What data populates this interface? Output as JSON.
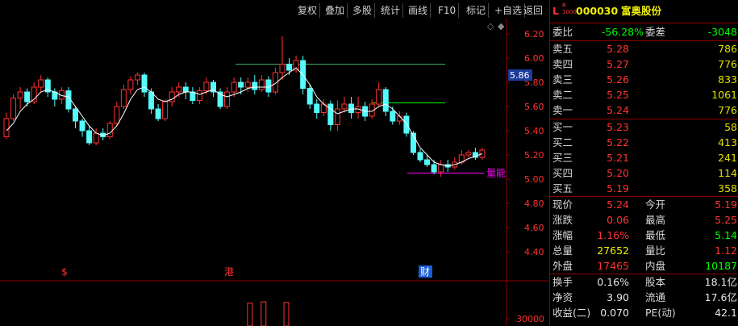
{
  "colors": {
    "up": "#ff3232",
    "down": "#54fcfc",
    "bg": "#000000",
    "grid": "#8b0000",
    "ma": "#ffffff",
    "yellow": "#f0f000",
    "purple": "#ff00ff",
    "green": "#00ff00"
  },
  "toolbar": {
    "items": [
      "复权",
      "叠加",
      "多股",
      "统计",
      "画线",
      "F10",
      "标记",
      "+自选",
      "返回"
    ]
  },
  "chart": {
    "y_ticks": [
      "6.20",
      "6.00",
      "5.80",
      "5.60",
      "5.40",
      "5.20",
      "5.00",
      "4.80",
      "4.60",
      "4.40"
    ],
    "current_price": "5.86",
    "vol_tick": "30000",
    "markers": [
      {
        "text": "$",
        "color": "#ff3232"
      },
      {
        "text": "港",
        "color": "#ff3232"
      },
      {
        "text": "财",
        "color": "#ffffff"
      }
    ],
    "indicator_label": "量能",
    "level_lines": [
      5.95,
      5.63,
      5.05
    ]
  },
  "chart_data": {
    "type": "candlestick",
    "ylim": [
      4.3,
      6.28
    ],
    "series": [
      {
        "name": "ohlc",
        "values": [
          [
            5.35,
            5.5,
            5.33,
            5.55
          ],
          [
            5.5,
            5.67,
            5.48,
            5.7
          ],
          [
            5.67,
            5.72,
            5.58,
            5.76
          ],
          [
            5.72,
            5.64,
            5.6,
            5.75
          ],
          [
            5.64,
            5.76,
            5.62,
            5.8
          ],
          [
            5.76,
            5.82,
            5.72,
            5.86
          ],
          [
            5.82,
            5.72,
            5.68,
            5.84
          ],
          [
            5.72,
            5.66,
            5.6,
            5.75
          ],
          [
            5.66,
            5.73,
            5.62,
            5.76
          ],
          [
            5.73,
            5.58,
            5.55,
            5.76
          ],
          [
            5.58,
            5.48,
            5.42,
            5.6
          ],
          [
            5.48,
            5.4,
            5.35,
            5.5
          ],
          [
            5.4,
            5.3,
            5.28,
            5.44
          ],
          [
            5.3,
            5.38,
            5.28,
            5.42
          ],
          [
            5.38,
            5.35,
            5.32,
            5.42
          ],
          [
            5.35,
            5.46,
            5.33,
            5.48
          ],
          [
            5.46,
            5.6,
            5.44,
            5.64
          ],
          [
            5.6,
            5.74,
            5.58,
            5.78
          ],
          [
            5.74,
            5.82,
            5.7,
            5.85
          ],
          [
            5.82,
            5.86,
            5.78,
            5.88
          ],
          [
            5.86,
            5.72,
            5.68,
            5.88
          ],
          [
            5.72,
            5.58,
            5.54,
            5.75
          ],
          [
            5.58,
            5.5,
            5.48,
            5.62
          ],
          [
            5.5,
            5.64,
            5.48,
            5.66
          ],
          [
            5.64,
            5.72,
            5.6,
            5.76
          ],
          [
            5.72,
            5.76,
            5.68,
            5.8
          ],
          [
            5.76,
            5.72,
            5.66,
            5.8
          ],
          [
            5.72,
            5.65,
            5.62,
            5.76
          ],
          [
            5.65,
            5.73,
            5.62,
            5.76
          ],
          [
            5.73,
            5.8,
            5.7,
            5.84
          ],
          [
            5.8,
            5.72,
            5.68,
            5.82
          ],
          [
            5.72,
            5.6,
            5.58,
            5.75
          ],
          [
            5.6,
            5.72,
            5.58,
            5.76
          ],
          [
            5.72,
            5.8,
            5.68,
            5.84
          ],
          [
            5.8,
            5.76,
            5.7,
            5.84
          ],
          [
            5.76,
            5.8,
            5.72,
            5.84
          ],
          [
            5.8,
            5.74,
            5.7,
            5.86
          ],
          [
            5.74,
            5.82,
            5.72,
            5.86
          ],
          [
            5.82,
            5.72,
            5.68,
            5.85
          ],
          [
            5.72,
            5.88,
            5.7,
            5.92
          ],
          [
            5.88,
            5.95,
            5.82,
            6.18
          ],
          [
            5.95,
            5.9,
            5.86,
            6.0
          ],
          [
            5.9,
            5.98,
            5.88,
            6.02
          ],
          [
            5.98,
            5.75,
            5.7,
            6.02
          ],
          [
            5.75,
            5.62,
            5.58,
            5.78
          ],
          [
            5.62,
            5.55,
            5.5,
            5.66
          ],
          [
            5.55,
            5.62,
            5.52,
            5.66
          ],
          [
            5.62,
            5.45,
            5.4,
            5.65
          ],
          [
            5.45,
            5.58,
            5.4,
            5.65
          ],
          [
            5.58,
            5.62,
            5.55,
            5.68
          ],
          [
            5.62,
            5.55,
            5.5,
            5.68
          ],
          [
            5.55,
            5.6,
            5.5,
            5.68
          ],
          [
            5.6,
            5.52,
            5.48,
            5.64
          ],
          [
            5.52,
            5.62,
            5.5,
            5.66
          ],
          [
            5.62,
            5.74,
            5.6,
            5.8
          ],
          [
            5.74,
            5.56,
            5.52,
            5.76
          ],
          [
            5.56,
            5.48,
            5.45,
            5.6
          ],
          [
            5.48,
            5.52,
            5.45,
            5.56
          ],
          [
            5.52,
            5.38,
            5.35,
            5.55
          ],
          [
            5.38,
            5.22,
            5.2,
            5.4
          ],
          [
            5.22,
            5.16,
            5.14,
            5.25
          ],
          [
            5.16,
            5.12,
            5.1,
            5.2
          ],
          [
            5.12,
            5.06,
            5.04,
            5.16
          ],
          [
            5.06,
            5.12,
            5.02,
            5.16
          ],
          [
            5.12,
            5.1,
            5.06,
            5.16
          ],
          [
            5.1,
            5.14,
            5.08,
            5.18
          ],
          [
            5.14,
            5.2,
            5.12,
            5.24
          ],
          [
            5.2,
            5.22,
            5.18,
            5.24
          ],
          [
            5.22,
            5.18,
            5.16,
            5.26
          ],
          [
            5.18,
            5.24,
            5.16,
            5.26
          ]
        ]
      },
      {
        "name": "ma",
        "values": [
          5.4,
          5.46,
          5.56,
          5.62,
          5.66,
          5.72,
          5.74,
          5.72,
          5.69,
          5.68,
          5.6,
          5.52,
          5.44,
          5.38,
          5.36,
          5.38,
          5.44,
          5.54,
          5.66,
          5.74,
          5.76,
          5.72,
          5.66,
          5.64,
          5.66,
          5.7,
          5.72,
          5.72,
          5.7,
          5.72,
          5.74,
          5.7,
          5.68,
          5.7,
          5.72,
          5.75,
          5.76,
          5.76,
          5.76,
          5.79,
          5.84,
          5.88,
          5.92,
          5.86,
          5.78,
          5.68,
          5.62,
          5.58,
          5.54,
          5.56,
          5.58,
          5.58,
          5.56,
          5.56,
          5.6,
          5.62,
          5.58,
          5.52,
          5.46,
          5.36,
          5.26,
          5.2,
          5.14,
          5.12,
          5.11,
          5.12,
          5.14,
          5.17,
          5.19,
          5.21
        ]
      }
    ],
    "volume_indices": [
      34,
      37,
      42
    ],
    "volume_values": [
      34000,
      36000,
      35000
    ]
  },
  "quote": {
    "code": "000030",
    "name": "富奥股份",
    "weibi": {
      "label": "委比",
      "value": "-56.28%",
      "label2": "委差",
      "value2": "-3048"
    },
    "asks": [
      {
        "label": "卖五",
        "price": "5.28",
        "vol": "786"
      },
      {
        "label": "卖四",
        "price": "5.27",
        "vol": "776"
      },
      {
        "label": "卖三",
        "price": "5.26",
        "vol": "833"
      },
      {
        "label": "卖二",
        "price": "5.25",
        "vol": "1061"
      },
      {
        "label": "卖一",
        "price": "5.24",
        "vol": "776"
      }
    ],
    "bids": [
      {
        "label": "买一",
        "price": "5.23",
        "vol": "58"
      },
      {
        "label": "买二",
        "price": "5.22",
        "vol": "413"
      },
      {
        "label": "买三",
        "price": "5.21",
        "vol": "241"
      },
      {
        "label": "买四",
        "price": "5.20",
        "vol": "114"
      },
      {
        "label": "买五",
        "price": "5.19",
        "vol": "358"
      }
    ],
    "stats": [
      {
        "k1": "现价",
        "v1": "5.24",
        "c1": "#ff3232",
        "k2": "今开",
        "v2": "5.19",
        "c2": "#ff3232"
      },
      {
        "k1": "涨跌",
        "v1": "0.06",
        "c1": "#ff3232",
        "k2": "最高",
        "v2": "5.25",
        "c2": "#ff3232"
      },
      {
        "k1": "涨幅",
        "v1": "1.16%",
        "c1": "#ff3232",
        "k2": "最低",
        "v2": "5.14",
        "c2": "#00ff00"
      },
      {
        "k1": "总量",
        "v1": "27652",
        "c1": "#f0f000",
        "k2": "量比",
        "v2": "1.12",
        "c2": "#ff3232"
      },
      {
        "k1": "外盘",
        "v1": "17465",
        "c1": "#ff3232",
        "k2": "内盘",
        "v2": "10187",
        "c2": "#00ff00"
      }
    ],
    "stats2": [
      {
        "k1": "换手",
        "v1": "0.16%",
        "k2": "股本",
        "v2": "18.1亿"
      },
      {
        "k1": "净资",
        "v1": "3.90",
        "k2": "流通",
        "v2": "17.6亿"
      },
      {
        "k1": "收益(二)",
        "v1": "0.070",
        "k2": "PE(动)",
        "v2": "42.1"
      }
    ]
  }
}
